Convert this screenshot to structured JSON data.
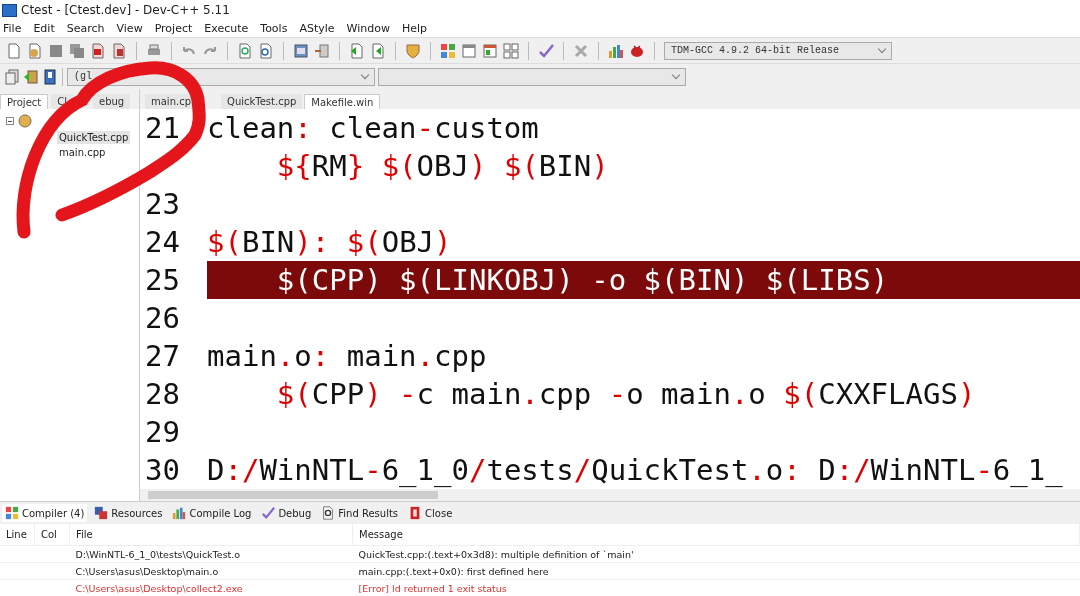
{
  "window": {
    "title": "Ctest - [Ctest.dev] - Dev-C++ 5.11"
  },
  "menu": [
    "File",
    "Edit",
    "Search",
    "View",
    "Project",
    "Execute",
    "Tools",
    "AStyle",
    "Window",
    "Help"
  ],
  "toolbar": {
    "compiler_select": "TDM-GCC 4.9.2 64-bit Release"
  },
  "toolbar2": {
    "scope_select": "(gl"
  },
  "left_tabs": [
    {
      "label": "Project",
      "selected": true
    },
    {
      "label": "Cl",
      "selected": false
    },
    {
      "label": "ebug",
      "selected": false
    }
  ],
  "project_tree": {
    "expanded": true,
    "children": [
      {
        "label": "QuickTest.cpp",
        "selected": true
      },
      {
        "label": "main.cpp",
        "selected": false
      }
    ]
  },
  "editor_tabs": [
    {
      "label": "main.cp",
      "selected": false
    },
    {
      "label": "QuickTest.cpp",
      "selected": false
    },
    {
      "label": "Makefile.win",
      "selected": true
    }
  ],
  "code_lines": [
    {
      "number": "21",
      "text": "clean: clean-custom",
      "highlighted": false
    },
    {
      "text": "    ${RM} $(OBJ) $(BIN)",
      "highlighted": false
    },
    {
      "number": "23",
      "highlighted": false
    },
    {
      "number": "24",
      "text": "$(BIN): $(OBJ)",
      "highlighted": false
    },
    {
      "number": "25",
      "text": "    $(CPP) $(LINKOBJ) -o $(BIN) $(LIBS)",
      "highlighted": true
    },
    {
      "number": "26",
      "highlighted": false
    },
    {
      "number": "27",
      "text": "main.o: main.cpp",
      "highlighted": false
    },
    {
      "number": "28",
      "text": "    $(CPP) -c main.cpp -o main.o $(CXXFLAGS)",
      "highlighted": false
    },
    {
      "number": "29",
      "highlighted": false
    },
    {
      "number": "30",
      "text": "D:/WinNTL-6_1_0/tests/QuickTest.o: D:/WinNTL-6_1_",
      "highlighted": false
    }
  ],
  "bottom_tabs": [
    {
      "label": "Compiler (4)",
      "selected": true
    },
    {
      "label": "Resources",
      "selected": false
    },
    {
      "label": "Compile Log",
      "selected": false
    },
    {
      "label": "Debug",
      "selected": false
    },
    {
      "label": "Find Results",
      "selected": false
    },
    {
      "label": "Close",
      "selected": false
    }
  ],
  "messages": {
    "columns": [
      "Line",
      "Col",
      "File",
      "Message"
    ],
    "rows": [
      {
        "file": "D:\\WinNTL-6_1_0\\tests\\QuickTest.o",
        "message": "QuickTest.cpp:(.text+0x3d8): multiple definition of `main'",
        "error": false
      },
      {
        "file": "C:\\Users\\asus\\Desktop\\main.o",
        "message": "main.cpp:(.text+0x0): first defined here",
        "error": false
      },
      {
        "file": "C:\\Users\\asus\\Desktop\\collect2.exe",
        "message": "[Error] ld returned 1 exit status",
        "error": true
      }
    ]
  }
}
